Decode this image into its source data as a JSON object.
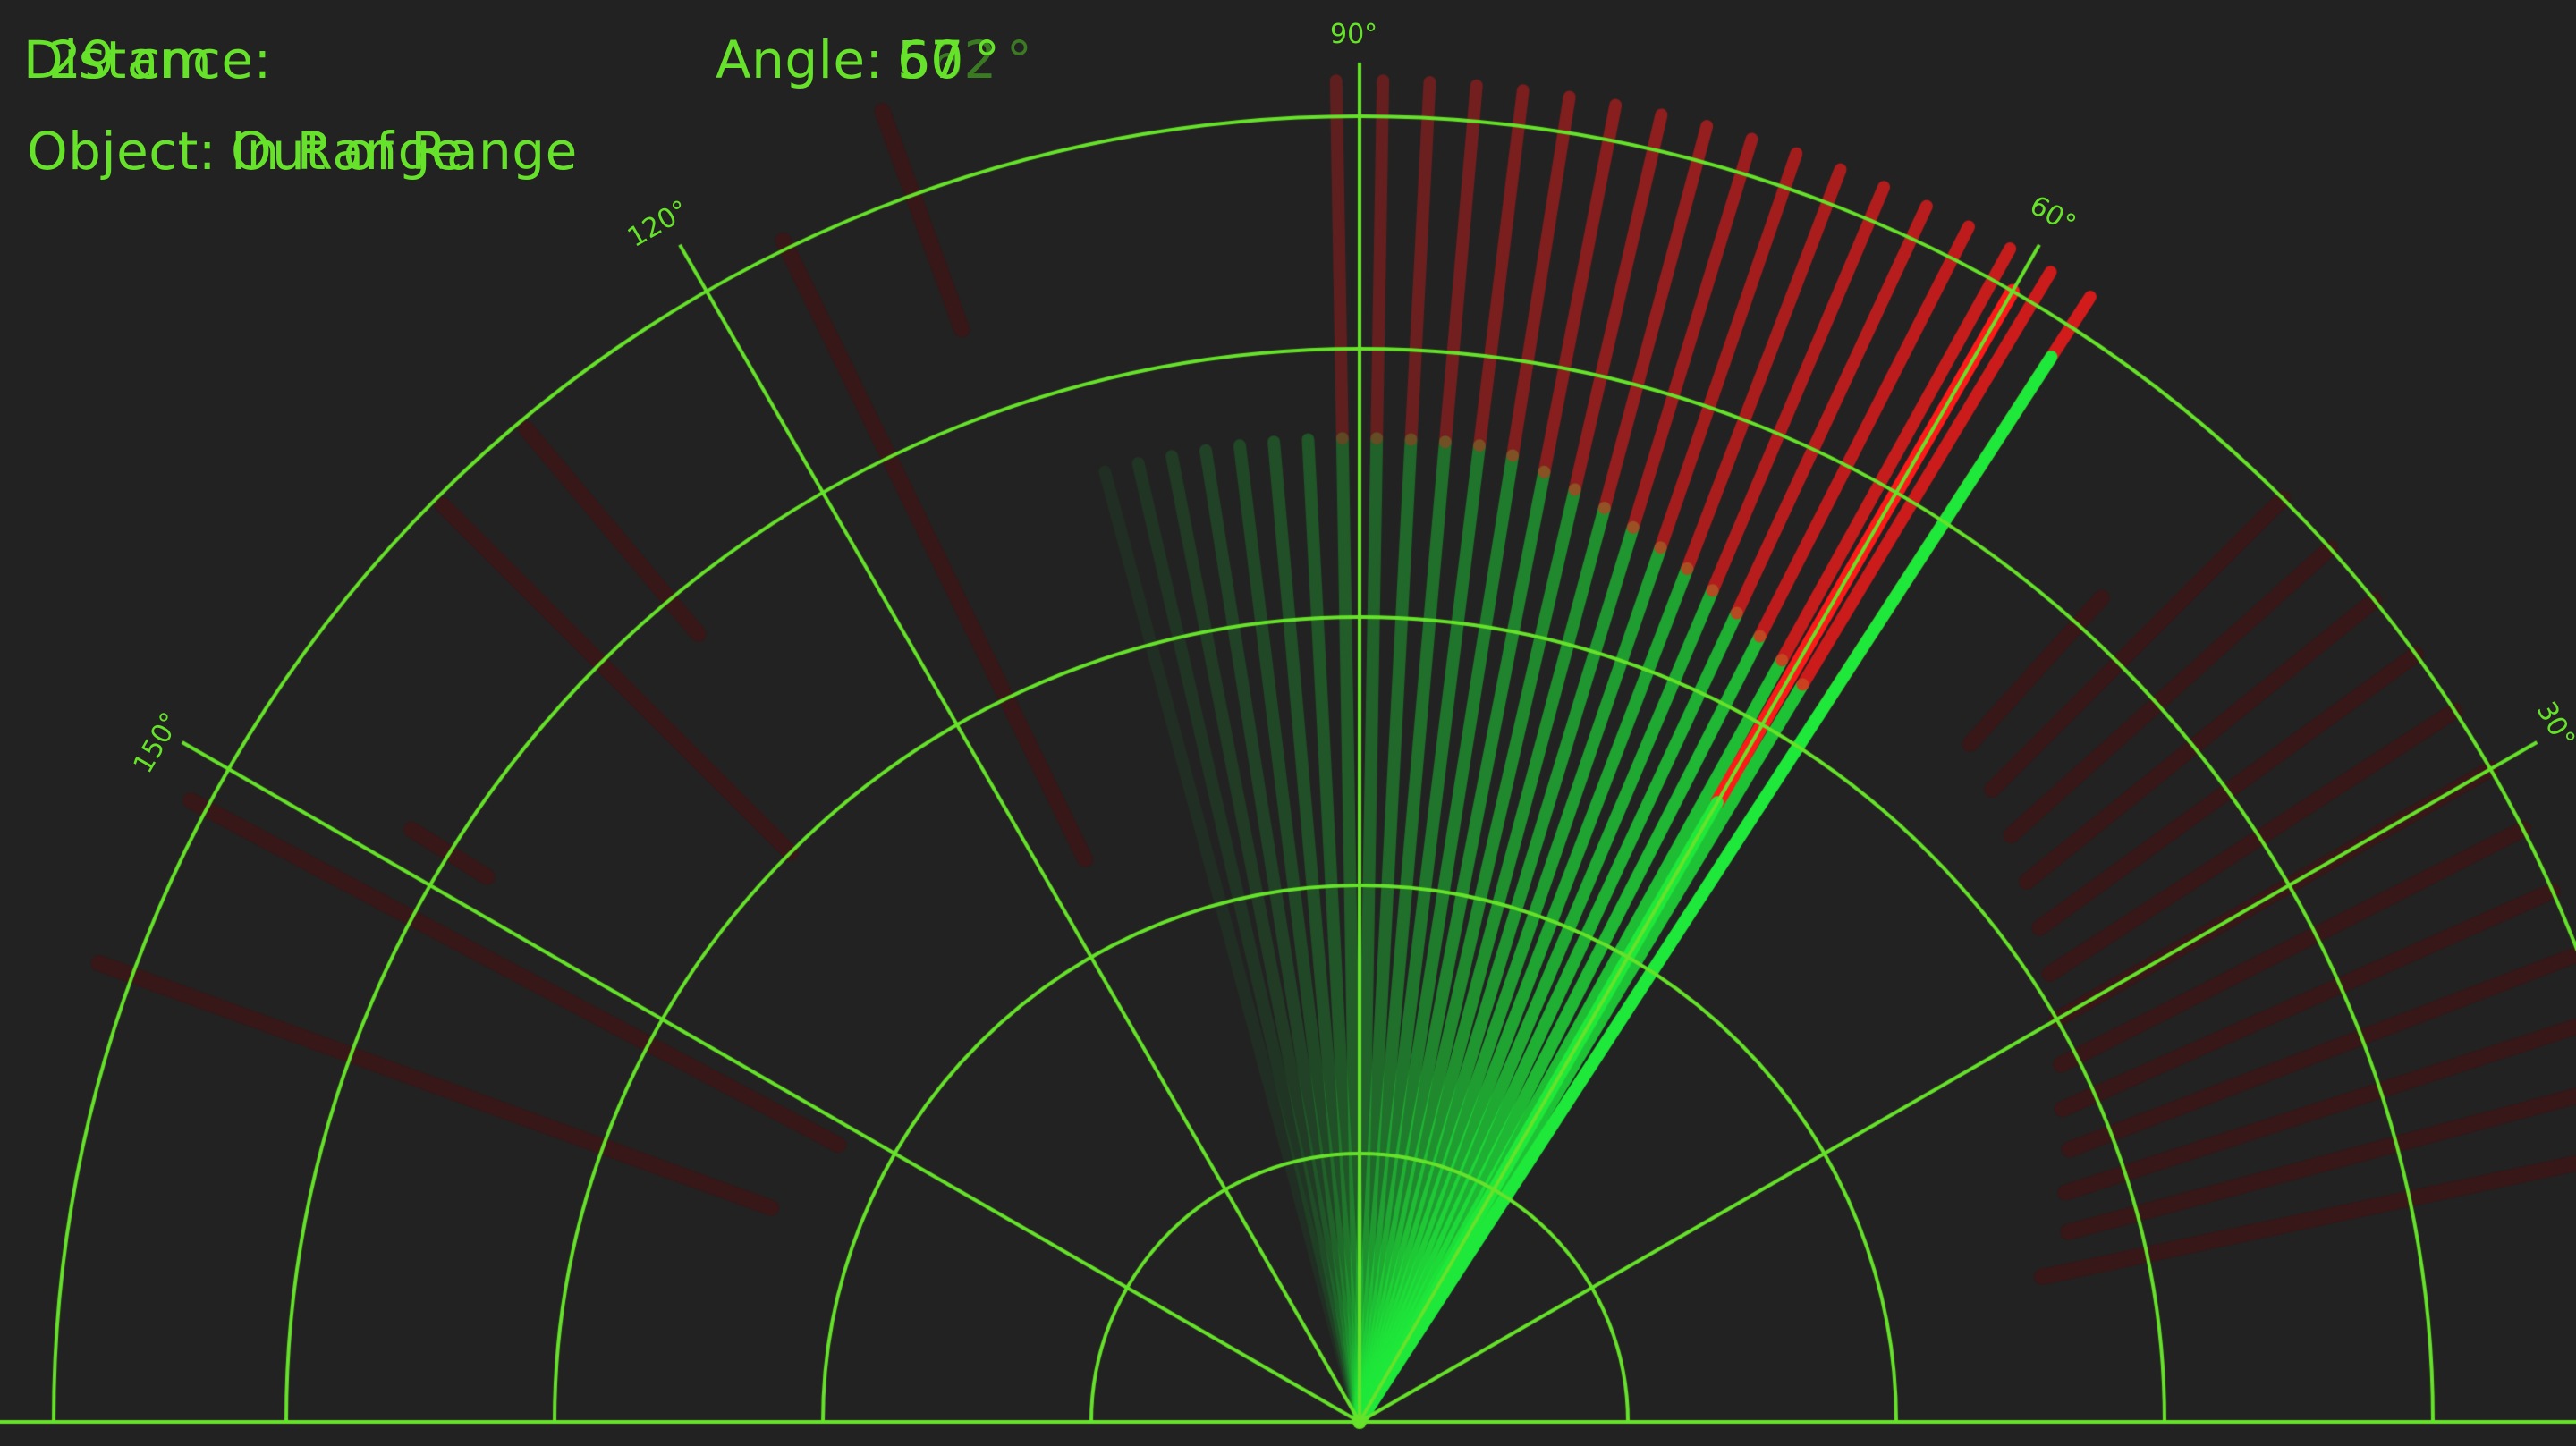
{
  "hud": {
    "distance_label": "Distance:",
    "distance_ghost_value": "29 cm",
    "object_label": "Object: ",
    "object_value_a": "Out of Range",
    "object_value_b": "In Range",
    "angle_label": "Angle: ",
    "angle_value_a": "60",
    "angle_value_b": "57",
    "angle_value_c": "62",
    "angle_value_d": "64",
    "angle_unit": " °"
  },
  "radar": {
    "angle_labels": [
      "30°",
      "60°",
      "90°",
      "120°",
      "150°"
    ],
    "colors": {
      "background": "#222222",
      "grid": "#66e22a",
      "sweep_green": "#1ee83a",
      "sweep_red": "#ff1a1a",
      "ghost_dark": "#3a1616"
    },
    "current_sweep_angle_deg": 57
  }
}
